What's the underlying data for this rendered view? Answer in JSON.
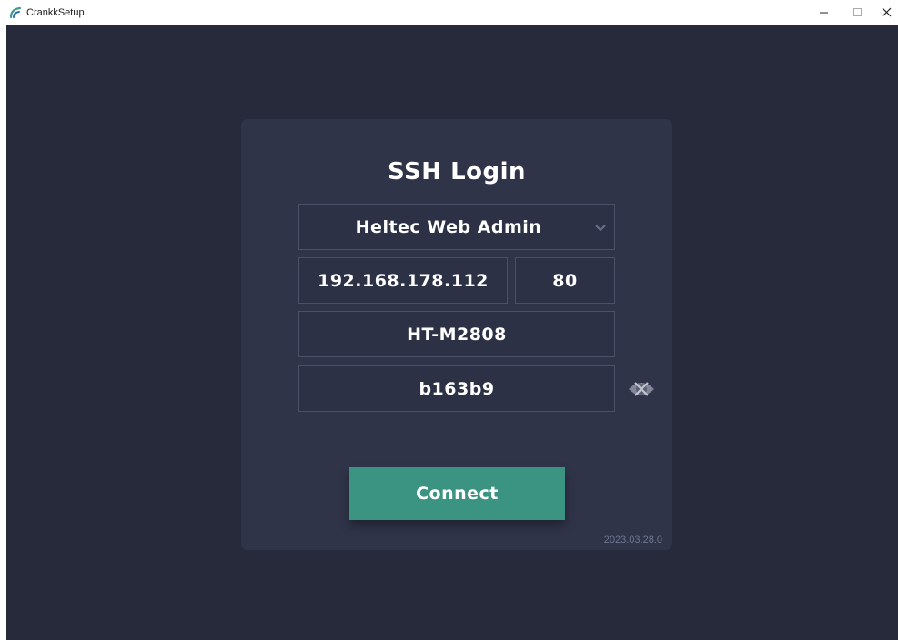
{
  "window": {
    "title": "CrankkSetup",
    "minimize_icon": "minimize-icon",
    "maximize_icon": "maximize-icon",
    "close_icon": "close-icon"
  },
  "colors": {
    "background": "#262a3b",
    "card": "#2f3449",
    "field_border": "#4a5068",
    "accent": "#3b9481",
    "text": "#ffffff",
    "version_text": "#707792"
  },
  "login": {
    "title": "SSH Login",
    "device_select": {
      "value": "Heltec Web Admin",
      "icon": "chevron-down-icon"
    },
    "host": {
      "value": "192.168.178.112"
    },
    "port": {
      "value": "80"
    },
    "username": {
      "value": "HT-M2808"
    },
    "password": {
      "value": "b163b9",
      "toggle_icon": "eye-icon"
    },
    "connect_label": "Connect",
    "version": "2023.03.28.0"
  }
}
